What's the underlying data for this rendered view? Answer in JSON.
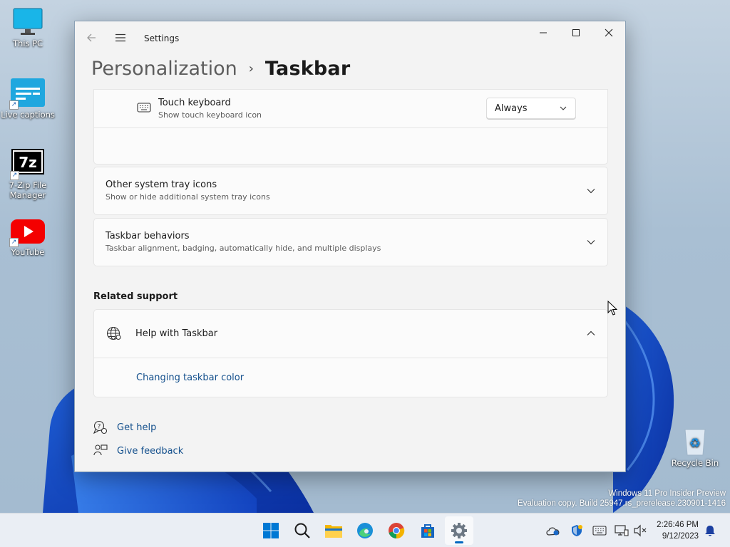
{
  "desktop": {
    "icons": [
      {
        "label": "This PC",
        "icon": "monitor-icon"
      },
      {
        "label": "Live captions",
        "icon": "live-captions-icon"
      },
      {
        "label": "7-Zip File\nManager",
        "icon": "7zip-icon",
        "logo_text": "7z"
      },
      {
        "label": "YouTube",
        "icon": "youtube-icon"
      },
      {
        "label": "Recycle Bin",
        "icon": "recycle-bin-icon"
      }
    ],
    "watermark": {
      "line1": "Windows 11 Pro Insider Preview",
      "line2": "Evaluation copy. Build 25947.rs_prerelease.230901-1416"
    }
  },
  "window": {
    "app_title": "Settings",
    "breadcrumb": {
      "parent": "Personalization",
      "separator": "›",
      "current": "Taskbar"
    },
    "controls": {
      "minimize": "minimize-icon",
      "maximize": "maximize-icon",
      "close": "close-icon"
    },
    "touch_keyboard": {
      "title": "Touch keyboard",
      "subtitle": "Show touch keyboard icon",
      "dropdown_value": "Always",
      "icon": "keyboard-icon"
    },
    "other_tray": {
      "title": "Other system tray icons",
      "subtitle": "Show or hide additional system tray icons"
    },
    "behaviors": {
      "title": "Taskbar behaviors",
      "subtitle": "Taskbar alignment, badging, automatically hide, and multiple displays"
    },
    "related_support": {
      "heading": "Related support",
      "help_title": "Help with Taskbar",
      "help_icon": "globe-icon",
      "link": "Changing taskbar color"
    },
    "footer": {
      "get_help": "Get help",
      "give_feedback": "Give feedback"
    }
  },
  "taskbar": {
    "apps": [
      "start-icon",
      "search-icon",
      "file-explorer-icon",
      "edge-icon",
      "chrome-icon",
      "store-icon",
      "settings-icon"
    ],
    "active_app": "settings-icon",
    "tray": [
      "onedrive-icon",
      "security-icon",
      "keyboard-icon",
      "network-icon",
      "volume-muted-icon"
    ],
    "time": "2:26:46 PM",
    "date": "9/12/2023",
    "notification_icon": "bell-icon"
  },
  "colors": {
    "accent": "#0067c0",
    "link": "#134f8c",
    "window_bg": "#f3f3f3",
    "card_bg": "#fbfbfb"
  }
}
